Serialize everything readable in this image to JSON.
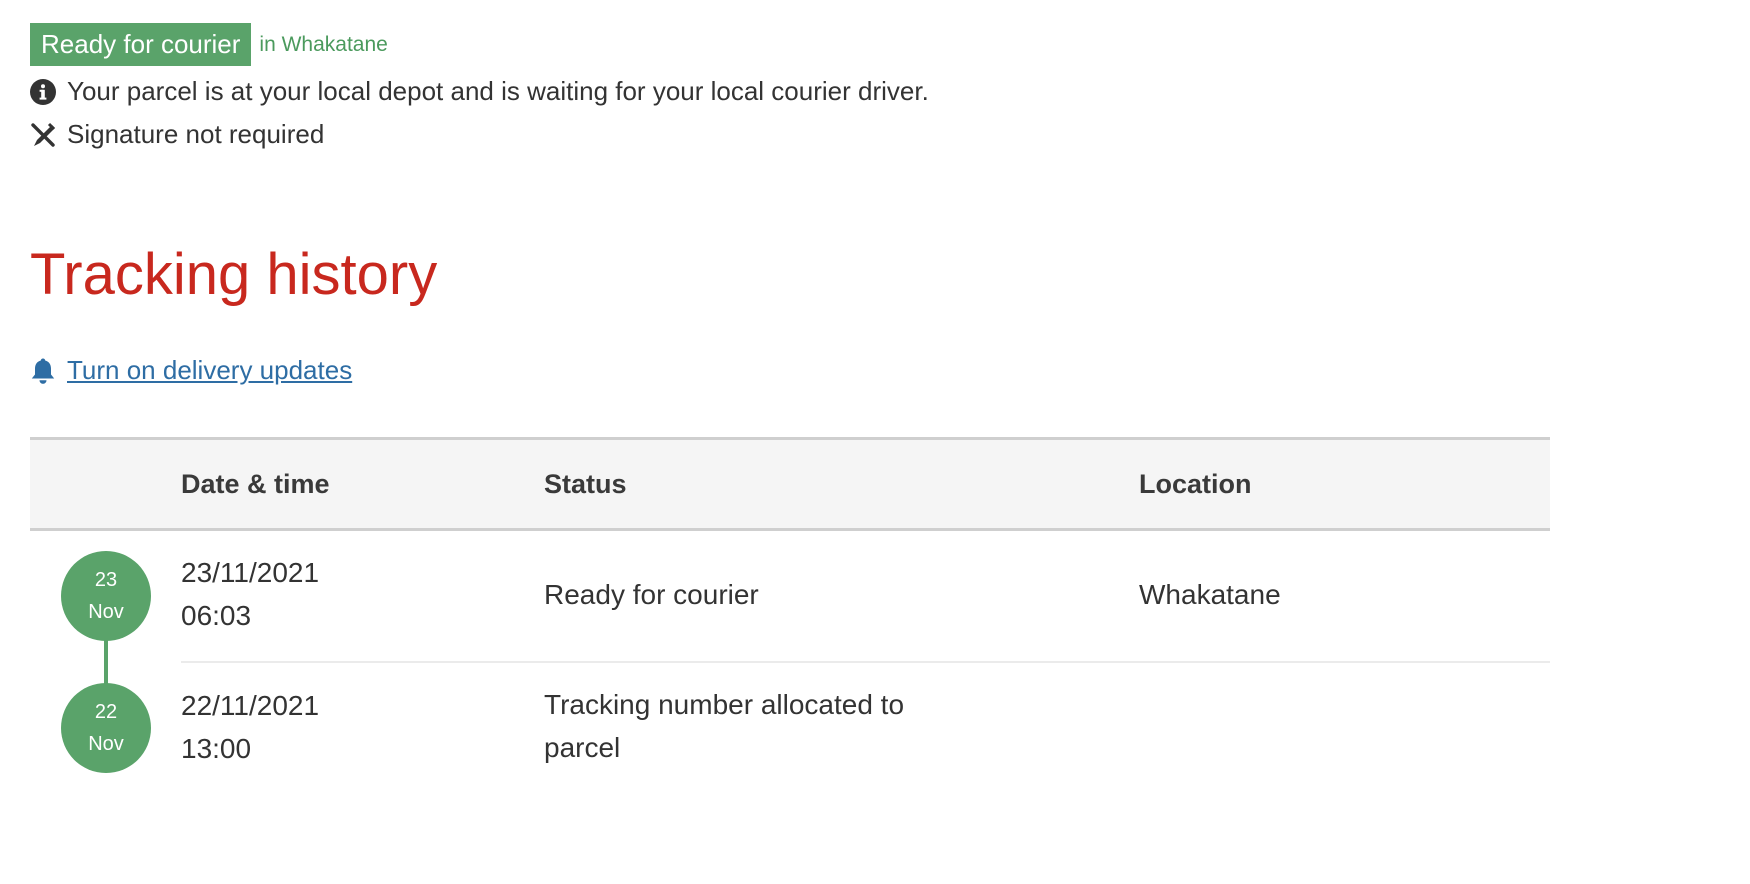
{
  "status": {
    "badge": "Ready for courier",
    "location": "in Whakatane",
    "badge_color": "#5aa36a"
  },
  "info": {
    "message": "Your parcel is at your local depot and is waiting for your local courier driver.",
    "message_icon": "info-icon",
    "signature": "Signature not required",
    "signature_icon": "no-signature-pen-icon"
  },
  "history": {
    "title": "Tracking history",
    "title_color": "#c8281e",
    "updates_link": "Turn on delivery updates",
    "updates_icon": "bell-icon",
    "columns": {
      "date": "Date & time",
      "status": "Status",
      "location": "Location"
    },
    "rows": [
      {
        "day": "23",
        "month": "Nov",
        "date": "23/11/2021",
        "time": "06:03",
        "status": "Ready for courier",
        "location": "Whakatane"
      },
      {
        "day": "22",
        "month": "Nov",
        "date": "22/11/2021",
        "time": "13:00",
        "status": "Tracking number allocated to parcel",
        "location": ""
      }
    ]
  }
}
